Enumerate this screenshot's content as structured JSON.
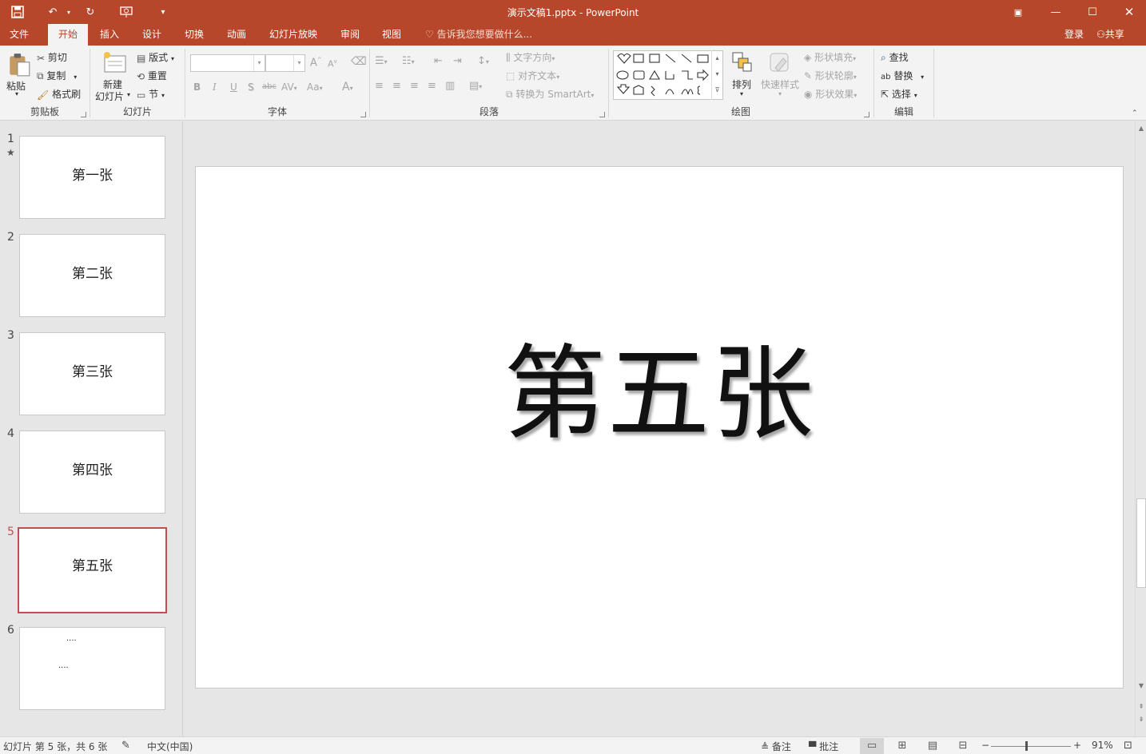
{
  "titlebar": {
    "title": "演示文稿1.pptx - PowerPoint"
  },
  "tabs": [
    "文件",
    "开始",
    "插入",
    "设计",
    "切换",
    "动画",
    "幻灯片放映",
    "审阅",
    "视图"
  ],
  "tell_me": "告诉我您想要做什么...",
  "account": {
    "login": "登录",
    "share": "共享"
  },
  "ribbon": {
    "clipboard": {
      "paste": "粘贴",
      "cut": "剪切",
      "copy": "复制",
      "format_painter": "格式刷",
      "label": "剪贴板"
    },
    "slides": {
      "new_slide_1": "新建",
      "new_slide_2": "幻灯片",
      "layout": "版式",
      "reset": "重置",
      "section": "节",
      "label": "幻灯片"
    },
    "font": {
      "label": "字体",
      "grow": "A",
      "shrink": "A",
      "bold": "B",
      "italic": "I",
      "underline": "U",
      "shadow": "S",
      "strike": "abc",
      "spacing": "AV",
      "case": "Aa",
      "color": "A"
    },
    "paragraph": {
      "text_direction": "文字方向",
      "align_text": "对齐文本",
      "smartart": "转换为 SmartArt",
      "label": "段落"
    },
    "drawing": {
      "arrange": "排列",
      "quick_styles": "快速样式",
      "shape_fill": "形状填充",
      "shape_outline": "形状轮廓",
      "shape_effects": "形状效果",
      "label": "绘图"
    },
    "editing": {
      "find": "查找",
      "replace": "替换",
      "select": "选择",
      "label": "编辑"
    }
  },
  "slides": [
    {
      "num": "1",
      "text": "第一张",
      "star": "★"
    },
    {
      "num": "2",
      "text": "第二张"
    },
    {
      "num": "3",
      "text": "第三张"
    },
    {
      "num": "4",
      "text": "第四张"
    },
    {
      "num": "5",
      "text": "第五张"
    },
    {
      "num": "6",
      "line1": "....",
      "line2": "...."
    }
  ],
  "current_slide": {
    "text": "第五张"
  },
  "status": {
    "slide_info": "幻灯片 第 5 张，共 6 张",
    "language": "中文(中国)",
    "notes": "备注",
    "comments": "批注",
    "zoom": "91%"
  },
  "colors": {
    "accent": "#b7472a",
    "selected_thumb": "#c0504d"
  }
}
